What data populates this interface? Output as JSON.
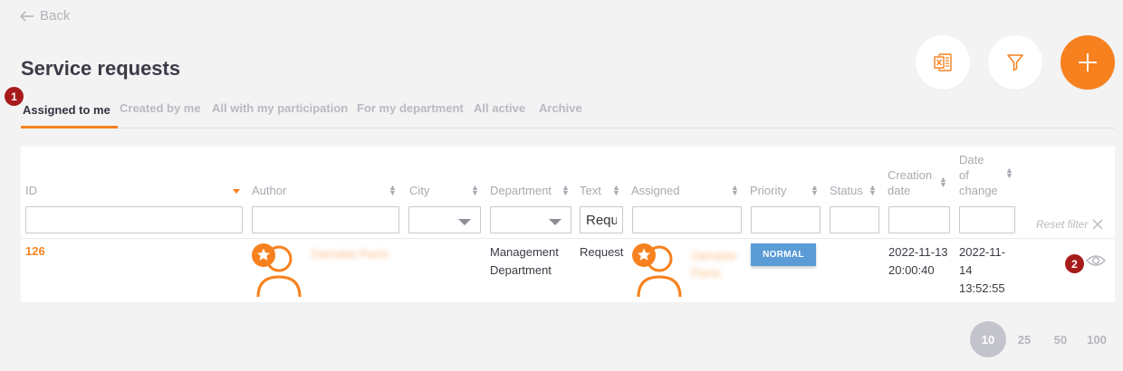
{
  "nav": {
    "back_label": "Back"
  },
  "page": {
    "title": "Service requests"
  },
  "tabs": [
    {
      "label": "Assigned to me",
      "active": true
    },
    {
      "label": "Created by me"
    },
    {
      "label": "All with my participation"
    },
    {
      "label": "For my department"
    },
    {
      "label": "All active"
    },
    {
      "label": "Archive"
    }
  ],
  "badges": {
    "first": "1",
    "second": "2"
  },
  "columns": {
    "id": "ID",
    "author": "Author",
    "city": "City",
    "department": "Department",
    "text": "Text",
    "assigned": "Assigned",
    "priority": "Priority",
    "status": "Status",
    "creation_date_1": "Creation",
    "creation_date_2": "date",
    "change_date_1": "Date",
    "change_date_2": "of",
    "change_date_3": "change"
  },
  "filters": {
    "text_value": "Requ",
    "reset_label": "Reset filter"
  },
  "row": {
    "id": "126",
    "author_name": "Zamaitai Panis",
    "department_1": "Management",
    "department_2": "Department",
    "text": "Request",
    "assigned_name_1": "Zamaitai",
    "assigned_name_2": "Panis",
    "priority": "NORMAL",
    "creation_date_1": "2022-11-13",
    "creation_date_2": "20:00:40",
    "change_date_1": "2022-11-",
    "change_date_2": "14",
    "change_date_3": "13:52:55"
  },
  "pagination": {
    "sizes": [
      "10",
      "25",
      "50",
      "100"
    ],
    "active": "10"
  },
  "colors": {
    "accent": "#f7811e",
    "priority": "#5b9bd6",
    "badge": "#a81b1b"
  },
  "icons": [
    "arrow-left-icon",
    "excel-icon",
    "filter-icon",
    "plus-icon",
    "close-icon",
    "eye-icon",
    "user-avatar-icon",
    "star-icon"
  ]
}
